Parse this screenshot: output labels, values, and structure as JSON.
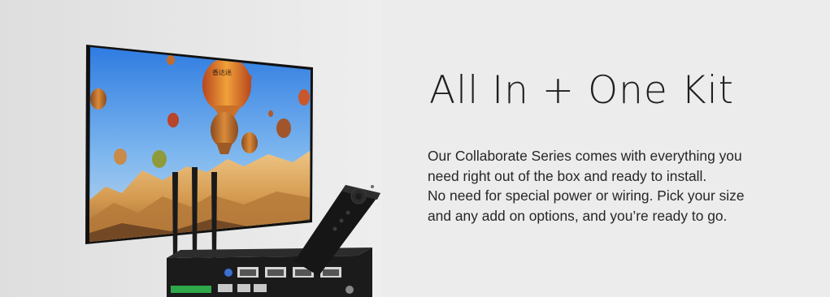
{
  "banner": {
    "title": "All In + One Kit",
    "description_lines": [
      "Our Collaborate Series comes with everything you",
      "need right out of the box and ready to install.",
      "No need for special power or wiring. Pick your size",
      "and any add on options, and you’re ready to go."
    ]
  },
  "product_image": {
    "screen_scene": "hot-air-balloons",
    "balloon_sign": "香达迷",
    "colors": {
      "background": "#ececec",
      "sky_top": "#2d7ee6",
      "sky_bottom": "#8cc2f5",
      "rock": "#d9a35a",
      "device": "#1b1b1b"
    }
  }
}
